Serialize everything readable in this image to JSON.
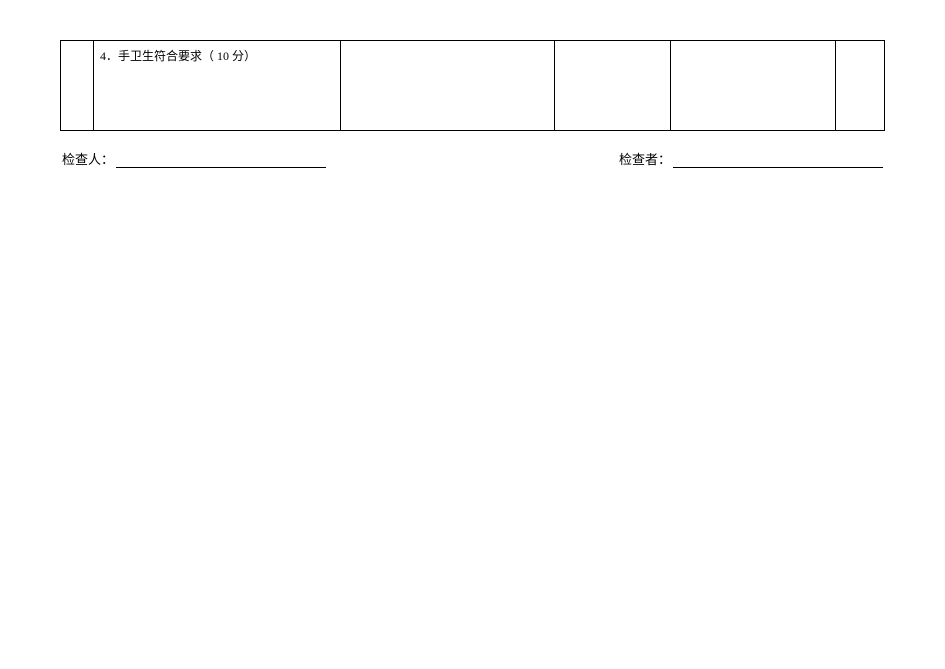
{
  "table": {
    "row": {
      "item_text": "4．手卫生符合要求（ 10 分）"
    }
  },
  "signatures": {
    "left_label": "检查人：",
    "right_label": "检查者："
  }
}
